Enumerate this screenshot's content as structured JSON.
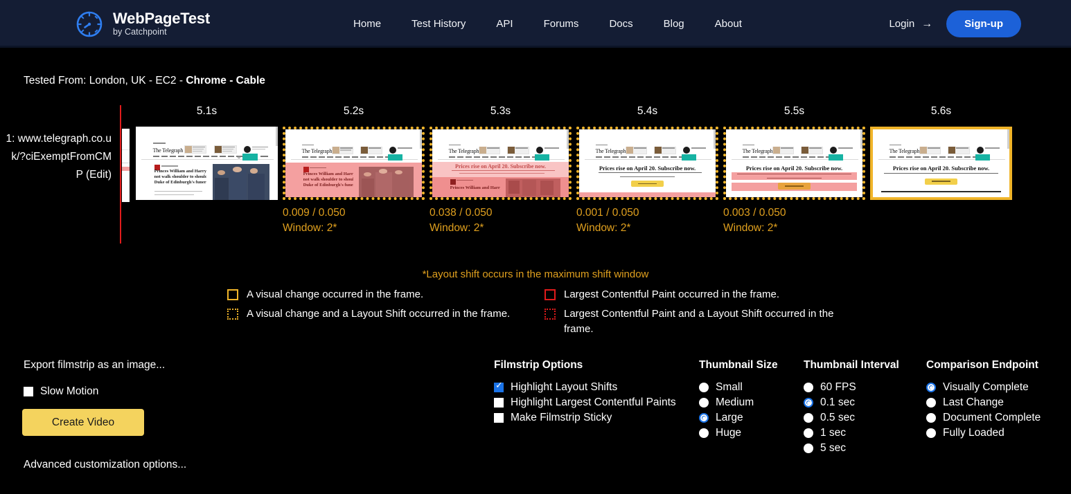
{
  "colors": {
    "header_bg": "#141d34",
    "page_bg": "#000000",
    "accent_blue": "#1c61d8",
    "shift_orange": "#f0b429",
    "cls_text_orange": "#e0a01e",
    "lcp_red": "#e01b1b",
    "marker_red": "#e01b1b",
    "button_yellow": "#f4d35e",
    "radio_selected": "#1a73e8"
  },
  "header": {
    "logo_icon": "speedometer-icon",
    "brand_name": "WebPageTest",
    "brand_tagline": "by Catchpoint",
    "nav": [
      {
        "label": "Home"
      },
      {
        "label": "Test History"
      },
      {
        "label": "API"
      },
      {
        "label": "Forums"
      },
      {
        "label": "Docs"
      },
      {
        "label": "Blog"
      },
      {
        "label": "About"
      }
    ],
    "login_label": "Login",
    "login_arrow": "→",
    "signup_label": "Sign-up"
  },
  "test_info": {
    "prefix": "Tested From: London, UK - EC2 - ",
    "browser_and_connection": "Chrome - Cable"
  },
  "filmstrip": {
    "row_label": "1: www.telegraph.co.uk/?ciExemptFromCMP (Edit)",
    "row_label_edit": "(Edit)",
    "frames": [
      {
        "time": "5.1s",
        "border": "none",
        "cls": "",
        "window": "",
        "state": "headline-photo"
      },
      {
        "time": "5.2s",
        "border": "dotted-orange",
        "cls": "0.009 / 0.050",
        "window": "Window: 2*",
        "state": "shift-headline-photo"
      },
      {
        "time": "5.3s",
        "border": "dotted-orange",
        "cls": "0.038 / 0.050",
        "window": "Window: 2*",
        "state": "shift-banner-appear"
      },
      {
        "time": "5.4s",
        "border": "dotted-orange",
        "cls": "0.001 / 0.050",
        "window": "Window: 2*",
        "state": "banner-settled"
      },
      {
        "time": "5.5s",
        "border": "dotted-orange",
        "cls": "0.003 / 0.050",
        "window": "Window: 2*",
        "state": "banner-shift"
      },
      {
        "time": "5.6s",
        "border": "solid-orange",
        "cls": "",
        "window": "",
        "state": "final"
      }
    ],
    "footnote": "*Layout shift occurs in the maximum shift window",
    "legend": {
      "left": [
        {
          "swatch": "solid-orange",
          "text": "A visual change occurred in the frame."
        },
        {
          "swatch": "dotted-orange",
          "text": "A visual change and a Layout Shift occurred in the frame."
        }
      ],
      "right": [
        {
          "swatch": "solid-red",
          "text": "Largest Contentful Paint occurred in the frame."
        },
        {
          "swatch": "dotted-red",
          "text": "Largest Contentful Paint and a Layout Shift occurred in the frame."
        }
      ]
    }
  },
  "thumb_page": {
    "masthead": "The Telegraph",
    "headline_shifted": "Prices rise on April 20. Subscribe now.",
    "article_headline_l1": "Princes William and Harry will",
    "article_headline_l2": "not walk shoulder to shoulder at",
    "article_headline_l3": "Duke of Edinburgh's funeral"
  },
  "bottom": {
    "export_label": "Export filmstrip as an image...",
    "slow_motion_label": "Slow Motion",
    "slow_motion_checked": false,
    "create_video_label": "Create Video",
    "advanced_label": "Advanced customization options...",
    "groups": [
      {
        "id": "filmstrip-options",
        "title": "Filmstrip Options",
        "control": "checkbox",
        "items": [
          {
            "label": "Highlight Layout Shifts",
            "checked": true
          },
          {
            "label": "Highlight Largest Contentful Paints",
            "checked": false
          },
          {
            "label": "Make Filmstrip Sticky",
            "checked": false
          }
        ]
      },
      {
        "id": "thumbnail-size",
        "title": "Thumbnail Size",
        "control": "radio",
        "items": [
          {
            "label": "Small",
            "checked": false
          },
          {
            "label": "Medium",
            "checked": false
          },
          {
            "label": "Large",
            "checked": true
          },
          {
            "label": "Huge",
            "checked": false
          }
        ]
      },
      {
        "id": "thumbnail-interval",
        "title": "Thumbnail Interval",
        "control": "radio",
        "items": [
          {
            "label": "60 FPS",
            "checked": false
          },
          {
            "label": "0.1 sec",
            "checked": true
          },
          {
            "label": "0.5 sec",
            "checked": false
          },
          {
            "label": "1 sec",
            "checked": false
          },
          {
            "label": "5 sec",
            "checked": false
          }
        ]
      },
      {
        "id": "comparison-endpoint",
        "title": "Comparison Endpoint",
        "control": "radio",
        "items": [
          {
            "label": "Visually Complete",
            "checked": true
          },
          {
            "label": "Last Change",
            "checked": false
          },
          {
            "label": "Document Complete",
            "checked": false
          },
          {
            "label": "Fully Loaded",
            "checked": false
          }
        ]
      }
    ]
  }
}
